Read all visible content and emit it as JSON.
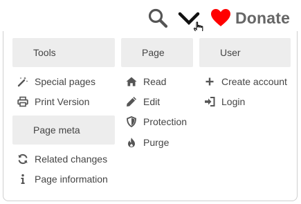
{
  "header": {
    "search_icon": "search-icon",
    "chevron_icon": "chevron-down-icon",
    "donate": {
      "icon": "heart-icon",
      "label": "Donate",
      "heart_color": "#ff0000"
    }
  },
  "menu": {
    "tools": {
      "heading": "Tools",
      "items": [
        {
          "label": "Special pages",
          "icon": "magic-wand-icon"
        },
        {
          "label": "Print Version",
          "icon": "printer-icon"
        }
      ]
    },
    "page_meta": {
      "heading": "Page meta",
      "items": [
        {
          "label": "Related changes",
          "icon": "refresh-icon"
        },
        {
          "label": "Page information",
          "icon": "info-icon"
        }
      ]
    },
    "page": {
      "heading": "Page",
      "items": [
        {
          "label": "Read",
          "icon": "home-icon"
        },
        {
          "label": "Edit",
          "icon": "pencil-icon"
        },
        {
          "label": "Protection",
          "icon": "shield-icon"
        },
        {
          "label": "Purge",
          "icon": "fire-icon"
        }
      ]
    },
    "user": {
      "heading": "User",
      "items": [
        {
          "label": "Create account",
          "icon": "plus-icon"
        },
        {
          "label": "Login",
          "icon": "sign-in-icon"
        }
      ]
    }
  }
}
